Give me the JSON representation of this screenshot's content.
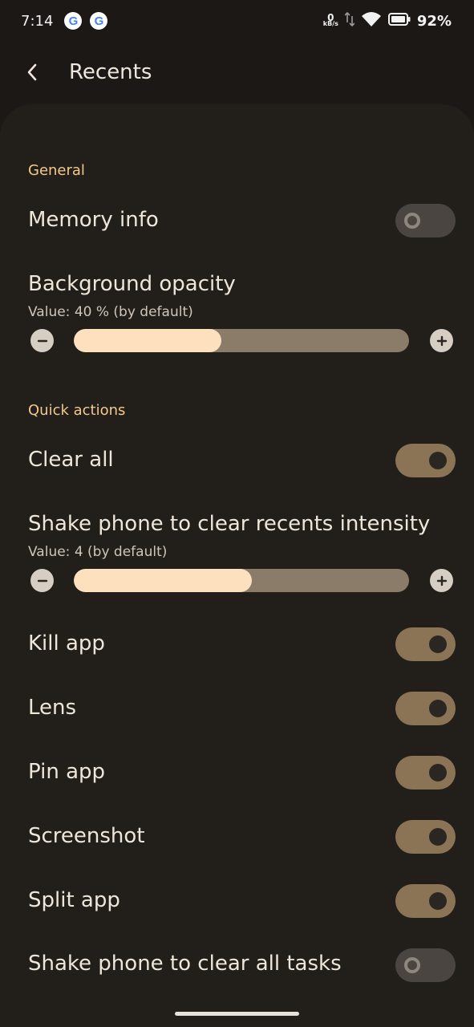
{
  "status_bar": {
    "time": "7:14",
    "net_speed_value": "0",
    "net_speed_unit": "kB/s",
    "battery": "92%",
    "icons": [
      "google-icon",
      "google-icon",
      "data-transfer-icon",
      "wifi-icon",
      "battery-icon"
    ]
  },
  "app_bar": {
    "title": "Recents"
  },
  "sections": {
    "general": "General",
    "quick_actions": "Quick actions"
  },
  "settings": {
    "memory_info": {
      "label": "Memory info",
      "enabled": false
    },
    "background_opacity": {
      "label": "Background opacity",
      "value_text": "Value: 40 % (by default)",
      "level": 0.44
    },
    "clear_all": {
      "label": "Clear all",
      "enabled": true
    },
    "shake_intensity": {
      "label": "Shake phone to clear recents intensity",
      "value_text": "Value: 4 (by default)",
      "level": 0.53
    },
    "kill_app": {
      "label": "Kill app",
      "enabled": true
    },
    "lens": {
      "label": "Lens",
      "enabled": true
    },
    "pin_app": {
      "label": "Pin app",
      "enabled": true
    },
    "screenshot": {
      "label": "Screenshot",
      "enabled": true
    },
    "split_app": {
      "label": "Split app",
      "enabled": true
    },
    "shake_clear_all": {
      "label": "Shake phone to clear all tasks",
      "enabled": false
    }
  },
  "colors": {
    "background": "#1b1815",
    "card": "#221f1b",
    "accent": "#f3c98c",
    "switch_on": "#8b7356",
    "slider_fill": "#fde1bf"
  }
}
